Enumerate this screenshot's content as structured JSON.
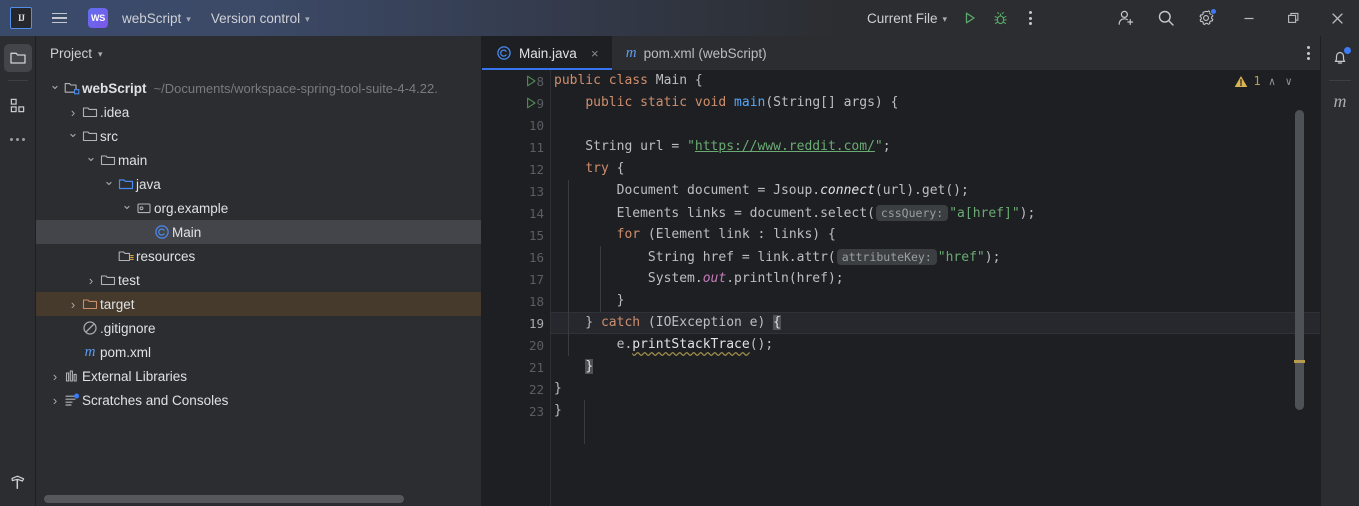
{
  "titlebar": {
    "logo_text": "IJ",
    "menu_icon": "hamburger-icon",
    "project_badge": "WS",
    "project_name": "webScript",
    "version_control": "Version control",
    "run_config": "Current File",
    "run_icon": "run-icon",
    "debug_icon": "debug-icon",
    "more_icon": "more-options-icon",
    "account_icon": "account-add-icon",
    "search_icon": "search-icon",
    "settings_icon": "settings-gear-icon",
    "minimize": "minimize-icon",
    "maximize": "maximize-icon",
    "close": "close-icon"
  },
  "rail_left": {
    "project_icon": "project-folder-icon",
    "structure_icon": "structure-icon",
    "more_icon": "more-tool-windows-icon",
    "build_icon": "build-hammer-icon"
  },
  "rail_right": {
    "notifications_icon": "notifications-bell-icon",
    "maven_label": "m"
  },
  "project_panel": {
    "title": "Project",
    "tree": [
      {
        "depth": 0,
        "twist": "down",
        "icon": "module-icon",
        "label": "webScript",
        "bold": true,
        "path": "~/Documents/workspace-spring-tool-suite-4-4.22."
      },
      {
        "depth": 1,
        "twist": "right",
        "icon": "folder-icon",
        "label": ".idea"
      },
      {
        "depth": 1,
        "twist": "down",
        "icon": "folder-icon",
        "label": "src"
      },
      {
        "depth": 2,
        "twist": "down",
        "icon": "folder-icon",
        "label": "main"
      },
      {
        "depth": 3,
        "twist": "down",
        "icon": "source-root-icon",
        "label": "java"
      },
      {
        "depth": 4,
        "twist": "down",
        "icon": "package-icon",
        "label": "org.example"
      },
      {
        "depth": 5,
        "twist": "none",
        "icon": "java-class-icon",
        "label": "Main",
        "selected": true
      },
      {
        "depth": 3,
        "twist": "none",
        "icon": "resources-icon",
        "label": "resources"
      },
      {
        "depth": 2,
        "twist": "right",
        "icon": "folder-icon",
        "label": "test"
      },
      {
        "depth": 1,
        "twist": "right",
        "icon": "excluded-folder-icon",
        "label": "target",
        "highlight": true
      },
      {
        "depth": 1,
        "twist": "none",
        "icon": "gitignore-icon",
        "label": ".gitignore"
      },
      {
        "depth": 1,
        "twist": "none",
        "icon": "maven-icon",
        "label": "pom.xml"
      },
      {
        "depth": 0,
        "twist": "right",
        "icon": "libraries-icon",
        "label": "External Libraries"
      },
      {
        "depth": 0,
        "twist": "right",
        "icon": "scratches-icon",
        "label": "Scratches and Consoles"
      }
    ]
  },
  "editor": {
    "tabs": [
      {
        "icon": "java-class-icon",
        "label": "Main.java",
        "active": true,
        "closable": true
      },
      {
        "icon": "maven-icon",
        "label": "pom.xml (webScript)",
        "active": false,
        "closable": false
      }
    ],
    "tab_close_glyph": "×",
    "more_icon": "editor-options-icon",
    "inspection": {
      "warning_icon": "warning-triangle-icon",
      "warning_count": "1",
      "prev_glyph": "∧",
      "next_glyph": "∨"
    },
    "first_line_number": 8,
    "current_line": 19,
    "lines": [
      {
        "n": 8,
        "run": true,
        "tokens": [
          {
            "t": "public ",
            "c": "kw"
          },
          {
            "t": "class ",
            "c": "kw"
          },
          {
            "t": "Main ",
            "c": "pl"
          },
          {
            "t": "{",
            "c": "pl"
          }
        ]
      },
      {
        "n": 9,
        "run": true,
        "tokens": [
          {
            "t": "    ",
            "c": "pl"
          },
          {
            "t": "public ",
            "c": "kw"
          },
          {
            "t": "static ",
            "c": "kw"
          },
          {
            "t": "void ",
            "c": "kw"
          },
          {
            "t": "main",
            "c": "mth"
          },
          {
            "t": "(String[] args) {",
            "c": "pl"
          }
        ]
      },
      {
        "n": 10,
        "run": false,
        "tokens": []
      },
      {
        "n": 11,
        "run": false,
        "tokens": [
          {
            "t": "    String url = ",
            "c": "pl"
          },
          {
            "t": "\"",
            "c": "str"
          },
          {
            "t": "https://www.reddit.com/",
            "c": "lnk"
          },
          {
            "t": "\"",
            "c": "str"
          },
          {
            "t": ";",
            "c": "pl"
          }
        ]
      },
      {
        "n": 12,
        "run": false,
        "tokens": [
          {
            "t": "    ",
            "c": "pl"
          },
          {
            "t": "try",
            "c": "kw"
          },
          {
            "t": " {",
            "c": "pl"
          }
        ]
      },
      {
        "n": 13,
        "run": false,
        "tokens": [
          {
            "t": "        Document document = Jsoup.",
            "c": "pl"
          },
          {
            "t": "connect",
            "c": "itl"
          },
          {
            "t": "(url).get();",
            "c": "pl"
          }
        ]
      },
      {
        "n": 14,
        "run": false,
        "tokens": [
          {
            "t": "        Elements links = document.select(",
            "c": "pl"
          },
          {
            "t": "cssQuery:",
            "c": "hint"
          },
          {
            "t": "\"a[href]\"",
            "c": "str"
          },
          {
            "t": ");",
            "c": "pl"
          }
        ]
      },
      {
        "n": 15,
        "run": false,
        "tokens": [
          {
            "t": "        ",
            "c": "pl"
          },
          {
            "t": "for",
            "c": "kw"
          },
          {
            "t": " (Element link : links) {",
            "c": "pl"
          }
        ]
      },
      {
        "n": 16,
        "run": false,
        "tokens": [
          {
            "t": "            String href = link.attr(",
            "c": "pl"
          },
          {
            "t": "attributeKey:",
            "c": "hint"
          },
          {
            "t": "\"href\"",
            "c": "str"
          },
          {
            "t": ");",
            "c": "pl"
          }
        ]
      },
      {
        "n": 17,
        "run": false,
        "tokens": [
          {
            "t": "            System.",
            "c": "pl"
          },
          {
            "t": "out",
            "c": "fld"
          },
          {
            "t": ".println(href);",
            "c": "pl"
          }
        ]
      },
      {
        "n": 18,
        "run": false,
        "tokens": [
          {
            "t": "        }",
            "c": "pl"
          }
        ]
      },
      {
        "n": 19,
        "run": false,
        "current": true,
        "tokens": [
          {
            "t": "    } ",
            "c": "pl"
          },
          {
            "t": "catch",
            "c": "kw"
          },
          {
            "t": " (IOException e) ",
            "c": "pl"
          },
          {
            "t": "{",
            "c": "caret-blk"
          }
        ]
      },
      {
        "n": 20,
        "run": false,
        "tokens": [
          {
            "t": "        e.",
            "c": "pl"
          },
          {
            "t": "printStackTrace",
            "c": "warnu"
          },
          {
            "t": "();",
            "c": "pl"
          }
        ]
      },
      {
        "n": 21,
        "run": false,
        "tokens": [
          {
            "t": "    ",
            "c": "pl"
          },
          {
            "t": "}",
            "c": "caret-blk"
          }
        ]
      },
      {
        "n": 22,
        "run": false,
        "tokens": [
          {
            "t": "}",
            "c": "pl"
          }
        ]
      },
      {
        "n": 23,
        "run": false,
        "tokens": [
          {
            "t": "}",
            "c": "pl"
          }
        ]
      }
    ]
  },
  "colors": {
    "accent_blue": "#3573f0",
    "warning_yellow": "#c9a34e",
    "run_green": "#59a869",
    "editor_bg": "#1e1f22",
    "panel_bg": "#2b2d30",
    "selection": "#43454a",
    "target_highlight": "#453a2c"
  }
}
